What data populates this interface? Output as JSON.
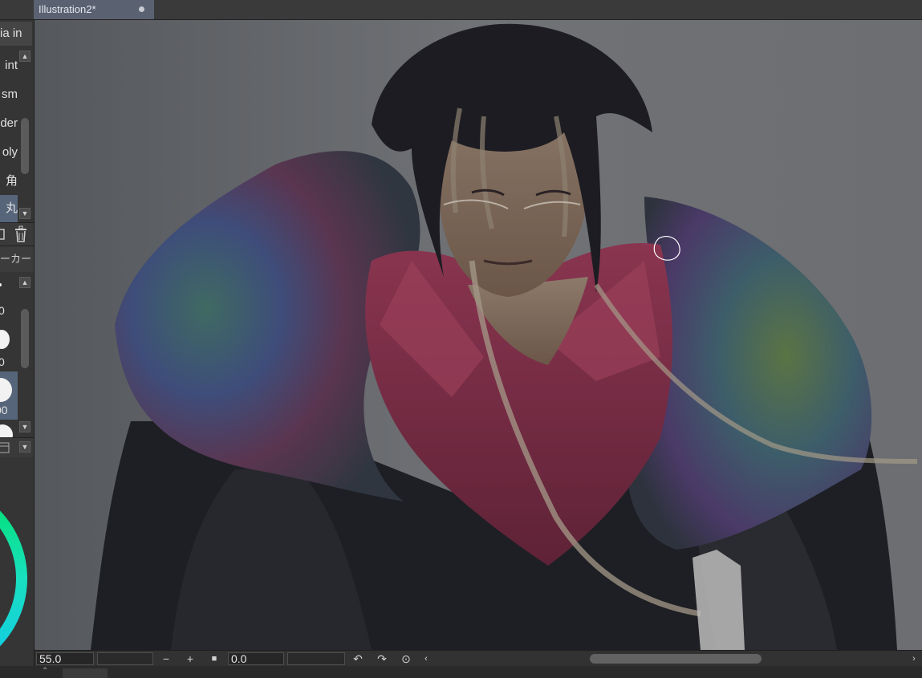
{
  "document_tab": {
    "title": "Illustration2*"
  },
  "brush_list": {
    "items": [
      "ia in",
      "int",
      "sm",
      "der",
      "oly",
      "角",
      "丸"
    ],
    "selected_index": 6
  },
  "sub_tool_tab": {
    "label": "ーカー"
  },
  "brush_size_list": {
    "items": [
      {
        "label": "0"
      },
      {
        "label": "0"
      },
      {
        "label": "00"
      }
    ],
    "selected_index": 2
  },
  "status_bar": {
    "zoom_value": "55.0",
    "rotation_value": "0.0",
    "zoom_out_icon": "minus-icon",
    "zoom_in_icon": "plus-icon",
    "fit_icon": "square-icon",
    "undo_icon": "rotate-left-icon",
    "redo_icon": "rotate-right-icon",
    "reset_icon": "reset-rotation-icon"
  },
  "colors": {
    "tab_active": "#5a6272",
    "selection": "#56657a",
    "panel_bg": "#353535",
    "color_ring_green": "#00e06a",
    "color_ring_cyan": "#12d8e0"
  }
}
